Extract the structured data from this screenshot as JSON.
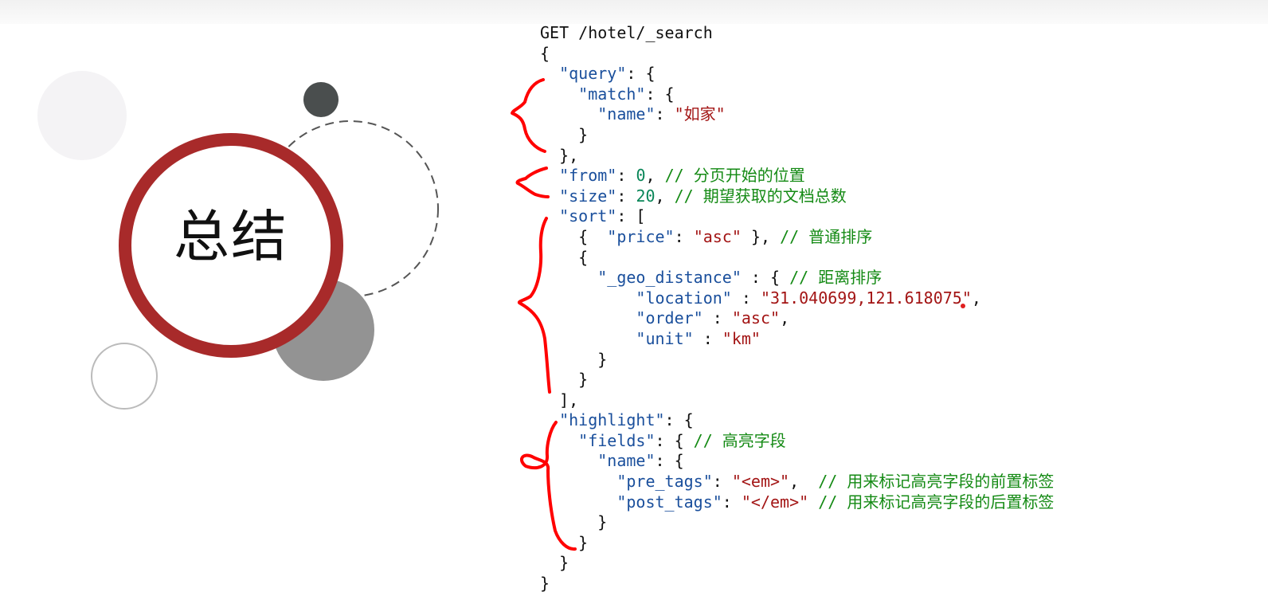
{
  "slide": {
    "title": "总结"
  },
  "code": {
    "lines": [
      [
        {
          "t": "GET /hotel/_search",
          "c": "p"
        }
      ],
      [
        {
          "t": "{",
          "c": "p"
        }
      ],
      [
        {
          "t": "  ",
          "c": "p"
        },
        {
          "t": "\"query\"",
          "c": "k"
        },
        {
          "t": ": {",
          "c": "p"
        }
      ],
      [
        {
          "t": "    ",
          "c": "p"
        },
        {
          "t": "\"match\"",
          "c": "k"
        },
        {
          "t": ": {",
          "c": "p"
        }
      ],
      [
        {
          "t": "      ",
          "c": "p"
        },
        {
          "t": "\"name\"",
          "c": "k"
        },
        {
          "t": ": ",
          "c": "p"
        },
        {
          "t": "\"如家\"",
          "c": "s"
        }
      ],
      [
        {
          "t": "    }",
          "c": "p"
        }
      ],
      [
        {
          "t": "  },",
          "c": "p"
        }
      ],
      [
        {
          "t": "  ",
          "c": "p"
        },
        {
          "t": "\"from\"",
          "c": "k"
        },
        {
          "t": ": ",
          "c": "p"
        },
        {
          "t": "0",
          "c": "n"
        },
        {
          "t": ", ",
          "c": "p"
        },
        {
          "t": "// 分页开始的位置",
          "c": "c"
        }
      ],
      [
        {
          "t": "  ",
          "c": "p"
        },
        {
          "t": "\"size\"",
          "c": "k"
        },
        {
          "t": ": ",
          "c": "p"
        },
        {
          "t": "20",
          "c": "n"
        },
        {
          "t": ", ",
          "c": "p"
        },
        {
          "t": "// 期望获取的文档总数",
          "c": "c"
        }
      ],
      [
        {
          "t": "  ",
          "c": "p"
        },
        {
          "t": "\"sort\"",
          "c": "k"
        },
        {
          "t": ": [",
          "c": "p"
        }
      ],
      [
        {
          "t": "    {  ",
          "c": "p"
        },
        {
          "t": "\"price\"",
          "c": "k"
        },
        {
          "t": ": ",
          "c": "p"
        },
        {
          "t": "\"asc\"",
          "c": "s"
        },
        {
          "t": " }, ",
          "c": "p"
        },
        {
          "t": "// 普通排序",
          "c": "c"
        }
      ],
      [
        {
          "t": "    {",
          "c": "p"
        }
      ],
      [
        {
          "t": "      ",
          "c": "p"
        },
        {
          "t": "\"_geo_distance\"",
          "c": "k"
        },
        {
          "t": " : { ",
          "c": "p"
        },
        {
          "t": "// 距离排序",
          "c": "c"
        }
      ],
      [
        {
          "t": "          ",
          "c": "p"
        },
        {
          "t": "\"location\"",
          "c": "k"
        },
        {
          "t": " : ",
          "c": "p"
        },
        {
          "t": "\"31.040699,121.618075\"",
          "c": "s"
        },
        {
          "t": ",",
          "c": "p"
        }
      ],
      [
        {
          "t": "          ",
          "c": "p"
        },
        {
          "t": "\"order\"",
          "c": "k"
        },
        {
          "t": " : ",
          "c": "p"
        },
        {
          "t": "\"asc\"",
          "c": "s"
        },
        {
          "t": ",",
          "c": "p"
        }
      ],
      [
        {
          "t": "          ",
          "c": "p"
        },
        {
          "t": "\"unit\"",
          "c": "k"
        },
        {
          "t": " : ",
          "c": "p"
        },
        {
          "t": "\"km\"",
          "c": "s"
        }
      ],
      [
        {
          "t": "      }",
          "c": "p"
        }
      ],
      [
        {
          "t": "    }",
          "c": "p"
        }
      ],
      [
        {
          "t": "  ],",
          "c": "p"
        }
      ],
      [
        {
          "t": "  ",
          "c": "p"
        },
        {
          "t": "\"highlight\"",
          "c": "k"
        },
        {
          "t": ": {",
          "c": "p"
        }
      ],
      [
        {
          "t": "    ",
          "c": "p"
        },
        {
          "t": "\"fields\"",
          "c": "k"
        },
        {
          "t": ": { ",
          "c": "p"
        },
        {
          "t": "// 高亮字段",
          "c": "c"
        }
      ],
      [
        {
          "t": "      ",
          "c": "p"
        },
        {
          "t": "\"name\"",
          "c": "k"
        },
        {
          "t": ": {",
          "c": "p"
        }
      ],
      [
        {
          "t": "        ",
          "c": "p"
        },
        {
          "t": "\"pre_tags\"",
          "c": "k"
        },
        {
          "t": ": ",
          "c": "p"
        },
        {
          "t": "\"<em>\"",
          "c": "s"
        },
        {
          "t": ",  ",
          "c": "p"
        },
        {
          "t": "// 用来标记高亮字段的前置标签",
          "c": "c"
        }
      ],
      [
        {
          "t": "        ",
          "c": "p"
        },
        {
          "t": "\"post_tags\"",
          "c": "k"
        },
        {
          "t": ": ",
          "c": "p"
        },
        {
          "t": "\"</em>\"",
          "c": "s"
        },
        {
          "t": " ",
          "c": "p"
        },
        {
          "t": "// 用来标记高亮字段的后置标签",
          "c": "c"
        }
      ],
      [
        {
          "t": "      }",
          "c": "p"
        }
      ],
      [
        {
          "t": "    }",
          "c": "p"
        }
      ],
      [
        {
          "t": "  }",
          "c": "p"
        }
      ],
      [
        {
          "t": "}",
          "c": "p"
        }
      ]
    ]
  },
  "colors": {
    "ring": "#a82a2a",
    "key": "#1a4f9c",
    "string": "#a31515",
    "number": "#098658",
    "comment": "#148a14",
    "annotation": "#ff0000"
  }
}
